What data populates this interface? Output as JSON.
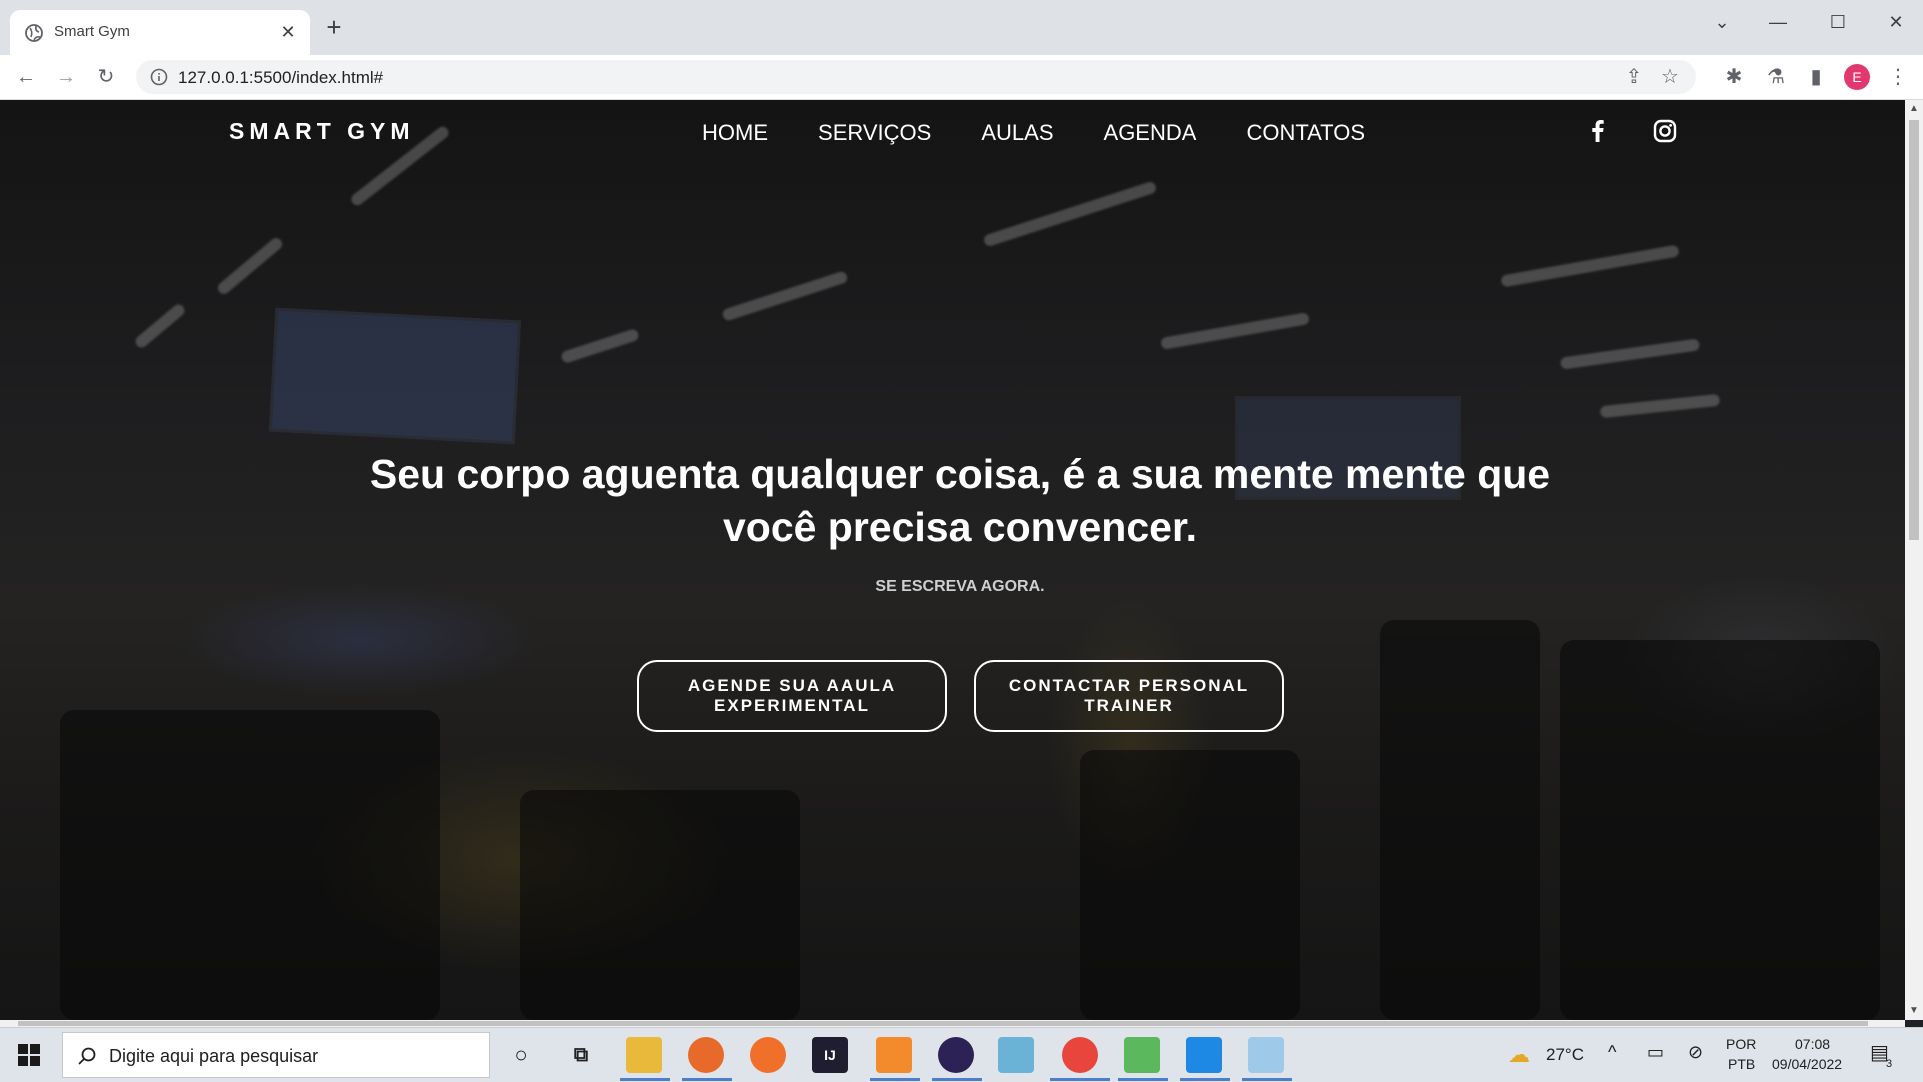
{
  "browser": {
    "tab_title": "Smart Gym",
    "url": "127.0.0.1:5500/index.html#",
    "profile_initial": "E"
  },
  "site": {
    "brand": "SMART GYM",
    "nav": [
      {
        "label": "HOME"
      },
      {
        "label": "SERVIÇOS"
      },
      {
        "label": "AULAS"
      },
      {
        "label": "AGENDA"
      },
      {
        "label": "CONTATOS"
      }
    ],
    "social": [
      "facebook-icon",
      "instagram-icon"
    ],
    "hero": {
      "title": "Seu corpo aguenta qualquer coisa, é a sua mente mente que você precisa convencer.",
      "subtitle": "SE ESCREVA AGORA.",
      "buttons": [
        {
          "label": "AGENDE SUA AAULA EXPERIMENTAL"
        },
        {
          "label": "CONTACTAR PERSONAL TRAINER"
        }
      ]
    }
  },
  "taskbar": {
    "search_placeholder": "Digite aqui para pesquisar",
    "weather": "27°C",
    "language_line1": "POR",
    "language_line2": "PTB",
    "time": "07:08",
    "date": "09/04/2022",
    "notifications": "3"
  },
  "colors": {
    "tabstrip": "#dee1e6",
    "taskbar": "#dfe4ea",
    "profile": "#e3386f"
  }
}
